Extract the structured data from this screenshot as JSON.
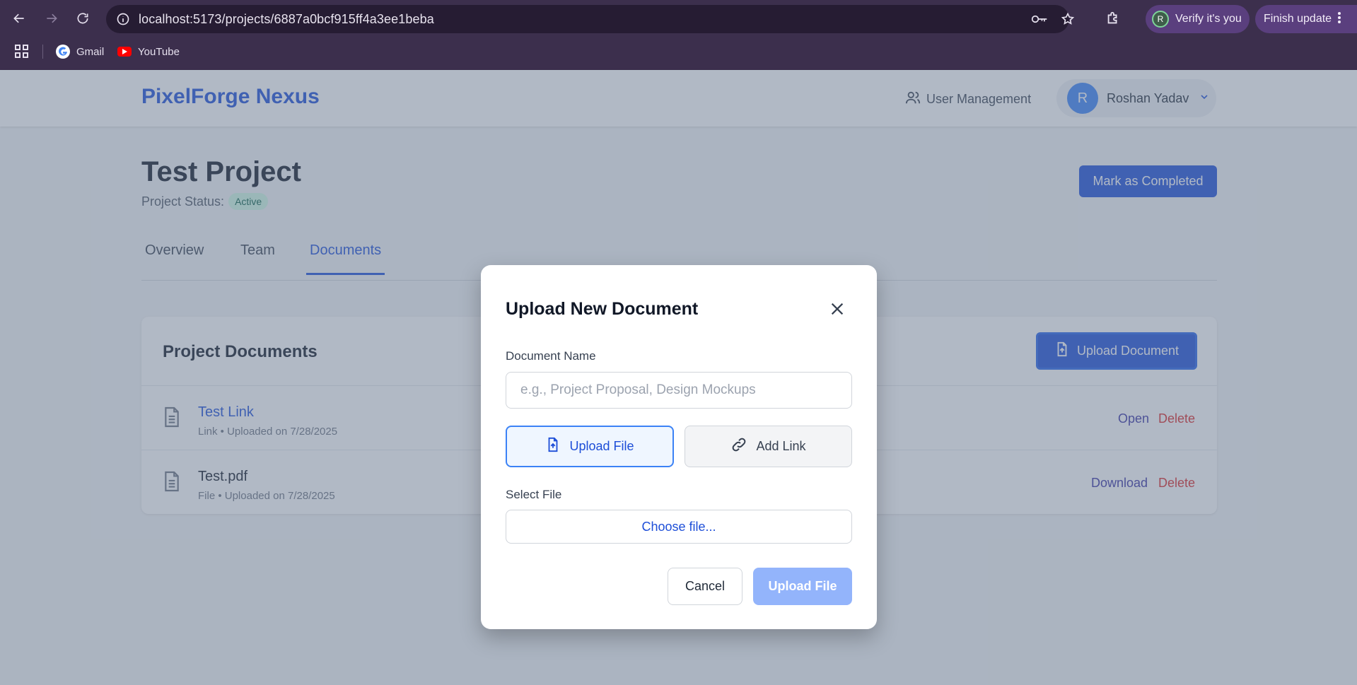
{
  "browser": {
    "url": "localhost:5173/projects/6887a0bcf915ff4a3ee1beba",
    "verify_chip": "Verify it's you",
    "verify_avatar": "R",
    "update_chip": "Finish update",
    "bookmarks": [
      {
        "label": "Gmail",
        "icon": "google-icon"
      },
      {
        "label": "YouTube",
        "icon": "youtube-icon"
      }
    ],
    "icons": [
      "back-icon",
      "forward-icon",
      "reload-icon",
      "site-info-icon",
      "key-icon",
      "star-icon",
      "extensions-icon",
      "apps-grid-icon",
      "more-vert-icon"
    ]
  },
  "header": {
    "brand": "PixelForge Nexus",
    "user_management": "User Management",
    "user_initial": "R",
    "user_name": "Roshan Yadav"
  },
  "project": {
    "title": "Test Project",
    "status_label": "Project Status:",
    "status_value": "Active",
    "complete_button": "Mark as Completed"
  },
  "tabs": [
    {
      "label": "Overview",
      "active": false
    },
    {
      "label": "Team",
      "active": false
    },
    {
      "label": "Documents",
      "active": true
    }
  ],
  "documents": {
    "title": "Project Documents",
    "upload_button": "Upload Document",
    "items": [
      {
        "name": "Test Link",
        "meta": "Link • Uploaded on 7/28/2025",
        "primary_action": "Open",
        "delete_action": "Delete"
      },
      {
        "name": "Test.pdf",
        "meta": "File • Uploaded on 7/28/2025",
        "primary_action": "Download",
        "delete_action": "Delete"
      }
    ]
  },
  "modal": {
    "title": "Upload New Document",
    "name_label": "Document Name",
    "name_placeholder": "e.g., Project Proposal, Design Mockups",
    "name_value": "",
    "toggle_file": "Upload File",
    "toggle_link": "Add Link",
    "selected_mode": "file",
    "select_file_label": "Select File",
    "choose_file": "Choose file...",
    "cancel": "Cancel",
    "submit": "Upload File"
  },
  "colors": {
    "brand": "#1d4ed8",
    "delete": "#dc2626",
    "overlay": "rgba(100,116,139,0.5)",
    "chrome": "#3c2f4d",
    "status_bg": "#d1fae5",
    "status_text": "#065f46"
  }
}
